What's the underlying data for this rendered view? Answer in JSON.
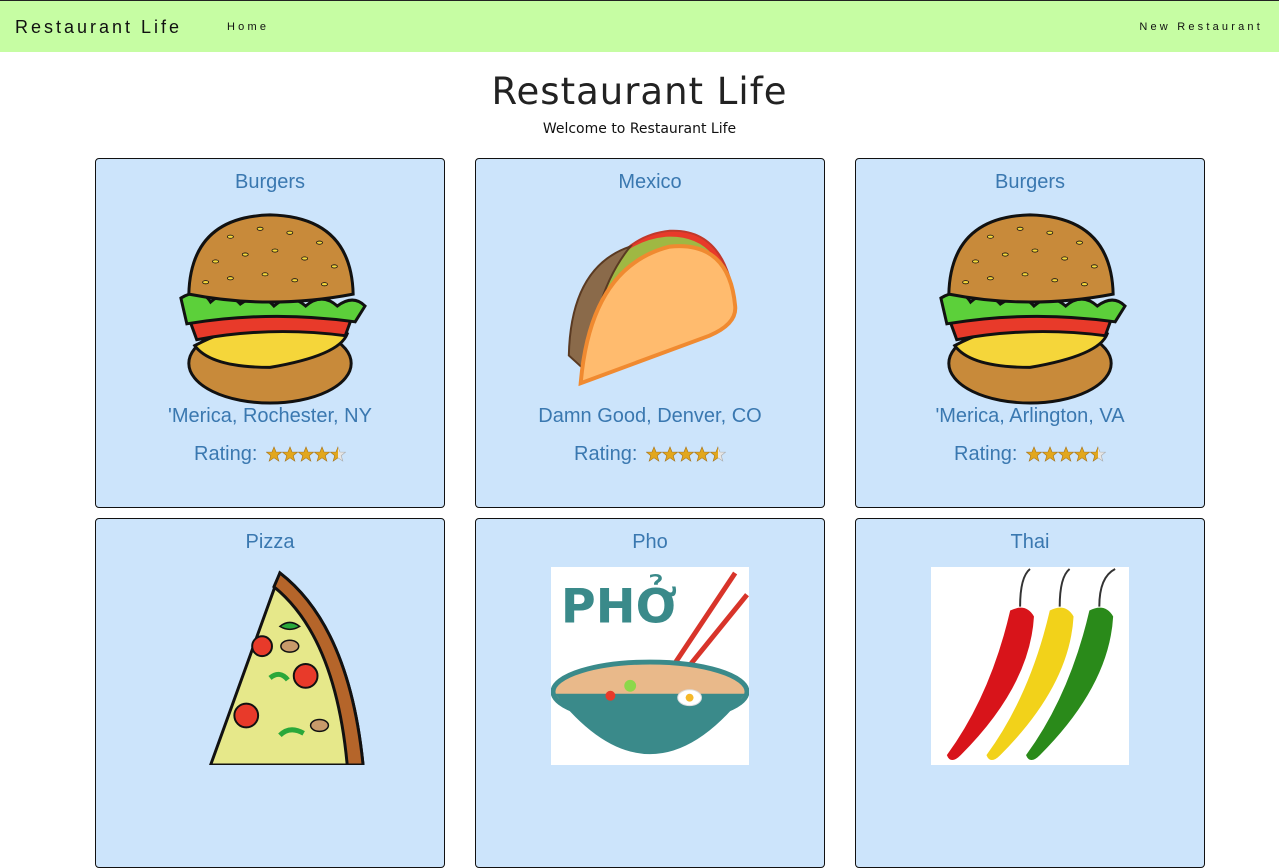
{
  "nav": {
    "brand": "Restaurant Life",
    "home": "Home",
    "new_restaurant": "New Restaurant"
  },
  "header": {
    "title": "Restaurant Life",
    "subtitle": "Welcome to Restaurant Life"
  },
  "rating_label": "Rating:",
  "cards": [
    {
      "cuisine": "Burgers",
      "location": "'Merica, Rochester, NY",
      "rating": 4.5,
      "image": "burger-icon"
    },
    {
      "cuisine": "Mexico",
      "location": "Damn Good, Denver, CO",
      "rating": 4.5,
      "image": "taco-icon"
    },
    {
      "cuisine": "Burgers",
      "location": "'Merica, Arlington, VA",
      "rating": 4.5,
      "image": "burger-icon"
    },
    {
      "cuisine": "Pizza",
      "image": "pizza-icon"
    },
    {
      "cuisine": "Pho",
      "image": "pho-icon",
      "image_text": "PHỞ"
    },
    {
      "cuisine": "Thai",
      "image": "chili-peppers-icon"
    }
  ],
  "colors": {
    "navbar": "#c6fda3",
    "card_bg": "#cce4fb",
    "link": "#3a78b0",
    "star": "#e2a71c"
  }
}
